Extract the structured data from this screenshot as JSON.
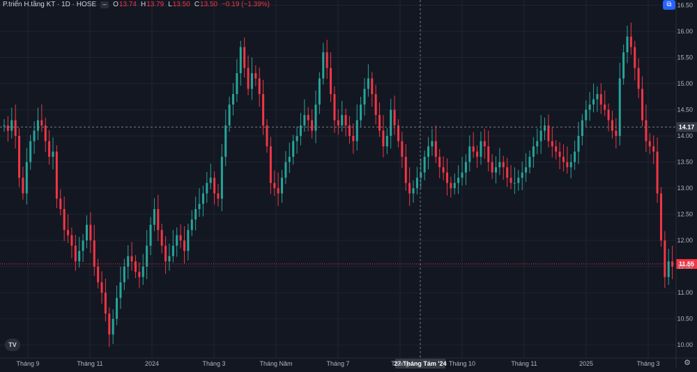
{
  "header": {
    "symbol": "P.triển H.tầng KT · 1D · HOSE",
    "collapse_icon": "minus-icon",
    "o_label": "O",
    "o_value": "13.74",
    "h_label": "H",
    "h_value": "13.79",
    "l_label": "L",
    "l_value": "13.50",
    "c_label": "C",
    "c_value": "13.50",
    "change": "−0.19 (−1.39%)"
  },
  "colors": {
    "background": "#131722",
    "up": "#26a69a",
    "down": "#f23645",
    "grid": "#1f2430",
    "text": "#d1d4dc",
    "crosshair_label": "#363a45",
    "accent": "#2962ff"
  },
  "logo_icon": "tradingview-logo-icon",
  "settings_icon": "gear-icon",
  "chart_data": {
    "type": "candlestick",
    "y_axis": {
      "min": 9.75,
      "max": 16.6,
      "ticks": [
        "10.00",
        "10.50",
        "11.00",
        "11.50",
        "12.00",
        "12.50",
        "13.00",
        "13.50",
        "14.00",
        "14.50",
        "15.00",
        "15.50",
        "16.00",
        "16.50"
      ]
    },
    "x_axis": {
      "ticks": [
        "Tháng 9",
        "Tháng 11",
        "2024",
        "Tháng 3",
        "Tháng Năm",
        "Tháng 7",
        "Tháng",
        "Tháng 10",
        "Tháng 11",
        "2025",
        "Tháng 3"
      ]
    },
    "crosshair": {
      "price_label": "14.17",
      "date_label": "27 Tháng Tám '24",
      "price": 14.17
    },
    "last_price": {
      "label": "11.55",
      "price": 11.55
    },
    "closes": [
      14.2,
      14.1,
      14.3,
      14.0,
      13.2,
      12.9,
      13.5,
      13.9,
      14.1,
      14.3,
      14.2,
      13.9,
      13.6,
      13.7,
      12.8,
      12.6,
      12.2,
      12.1,
      11.9,
      11.6,
      11.8,
      12.0,
      12.3,
      12.0,
      11.5,
      11.2,
      11.0,
      10.6,
      10.2,
      10.5,
      10.9,
      11.2,
      11.5,
      11.7,
      11.6,
      11.4,
      11.3,
      11.5,
      11.9,
      12.3,
      12.6,
      12.2,
      11.9,
      11.6,
      11.7,
      11.9,
      12.1,
      12.0,
      11.8,
      12.2,
      12.4,
      12.6,
      12.7,
      12.9,
      13.1,
      13.2,
      12.9,
      12.8,
      13.6,
      14.2,
      14.6,
      14.8,
      15.2,
      15.7,
      15.3,
      14.9,
      15.2,
      15.1,
      14.8,
      14.2,
      13.8,
      13.1,
      13.0,
      12.9,
      13.2,
      13.5,
      13.6,
      13.9,
      14.0,
      14.2,
      14.4,
      14.3,
      14.1,
      14.6,
      15.1,
      15.6,
      15.3,
      14.8,
      14.3,
      14.2,
      14.4,
      14.2,
      14.0,
      13.9,
      14.3,
      14.6,
      14.9,
      15.1,
      14.8,
      14.4,
      14.1,
      13.8,
      14.0,
      14.5,
      14.2,
      13.9,
      13.6,
      13.1,
      12.9,
      13.0,
      13.2,
      13.3,
      13.6,
      13.8,
      13.9,
      13.6,
      13.4,
      13.3,
      13.1,
      13.0,
      13.1,
      13.2,
      13.3,
      13.5,
      13.8,
      13.7,
      13.6,
      13.9,
      13.8,
      13.5,
      13.3,
      13.4,
      13.5,
      13.4,
      13.2,
      13.1,
      13.1,
      13.2,
      13.3,
      13.4,
      13.6,
      13.8,
      13.9,
      14.1,
      14.2,
      13.9,
      13.8,
      13.7,
      13.6,
      13.5,
      13.4,
      13.5,
      13.7,
      14.0,
      14.3,
      14.5,
      14.6,
      14.7,
      14.8,
      14.6,
      14.5,
      14.3,
      14.1,
      14.0,
      15.1,
      15.6,
      15.9,
      15.7,
      15.3,
      14.9,
      14.3,
      13.9,
      13.8,
      13.7,
      12.9,
      12.0,
      11.3,
      11.6,
      11.5
    ]
  }
}
